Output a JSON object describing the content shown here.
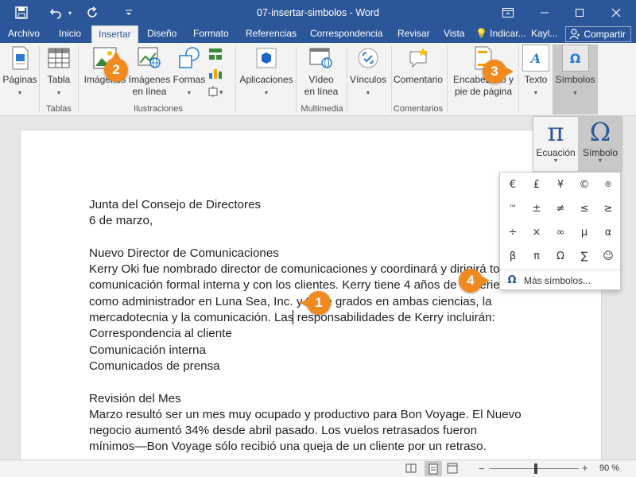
{
  "window": {
    "title": "07-insertar-simbolos - Word",
    "accent": "#2b579a",
    "callout_color": "#f08a1e"
  },
  "tabs": [
    "Archivo",
    "Inicio",
    "Insertar",
    "Diseño",
    "Formato",
    "Referencias",
    "Correspondencia",
    "Revisar",
    "Vista"
  ],
  "tell_me": "Indicar...",
  "user": "Kayl...",
  "share_label": "Compartir",
  "ribbon": {
    "paginas": "Páginas",
    "tabla": "Tabla",
    "imagenes": "Imágenes",
    "imagenes_linea_1": "Imágenes",
    "imagenes_linea_2": "en línea",
    "formas": "Formas",
    "aplicaciones": "Aplicaciones",
    "video_1": "Vídeo",
    "video_2": "en línea",
    "vinculos": "Vínculos",
    "comentario": "Comentario",
    "encabezado_1": "Encabezado y",
    "encabezado_2": "pie de página",
    "texto": "Texto",
    "simbolos": "Símbolos",
    "groups": {
      "tablas": "Tablas",
      "ilustraciones": "Ilustraciones",
      "multimedia": "Multimedia",
      "comentarios": "Comentarios"
    }
  },
  "symbols_popup": {
    "ecuacion": "Ecuación",
    "simbolo": "Símbolo"
  },
  "symbol_grid": [
    "€",
    "£",
    "¥",
    "©",
    "®",
    "™",
    "±",
    "≠",
    "≤",
    "≥",
    "÷",
    "×",
    "∞",
    "µ",
    "α",
    "β",
    "π",
    "Ω",
    "∑",
    "☺"
  ],
  "more_symbols": "Más símbolos...",
  "document_lines": [
    "Junta del Consejo de Directores",
    "6 de marzo,",
    "",
    "Nuevo Director de Comunicaciones",
    "Kerry Oki fue nombrado director de comunicaciones y coordinará y dirigirá toda",
    "comunicación formal interna y con los clientes. Kerry tiene 4 años de experiencia",
    "como administrador en Luna Sea, Inc. y tiene grados en ambas ciencias, la",
    "mercadotecnia y la comunicación. Las responsabilidades de Kerry incluirán:",
    "Correspondencia al cliente",
    "Comunicación interna",
    "Comunicados de prensa",
    "",
    "Revisión del Mes",
    "Marzo resultó ser un mes muy ocupado y productivo para Bon Voyage. El Nuevo",
    "negocio aumentó 34% desde abril pasado. Los vuelos retrasados fueron",
    "mínimos—Bon Voyage sólo recibió una queja de un cliente por un retraso."
  ],
  "zoom_level": "90 %",
  "callouts": [
    "1",
    "2",
    "3",
    "4"
  ]
}
